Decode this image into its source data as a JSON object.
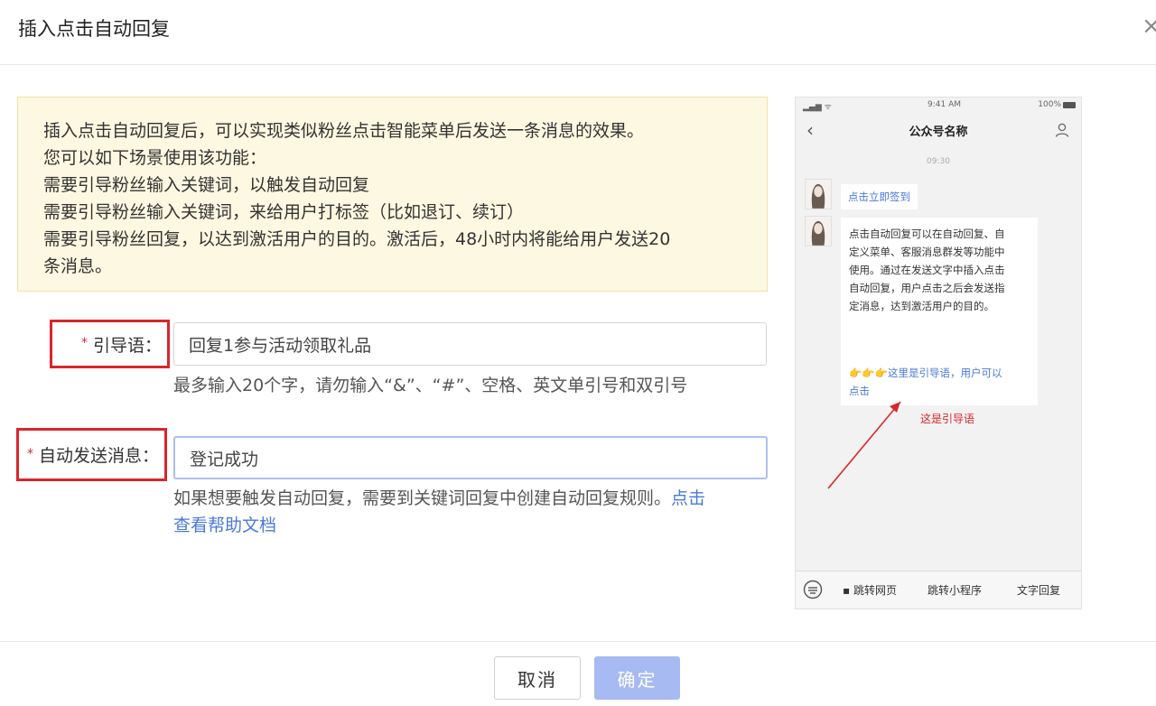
{
  "dialog": {
    "title": "插入点击自动回复",
    "close_glyph": "×"
  },
  "notice": {
    "lines": [
      "插入点击自动回复后，可以实现类似粉丝点击智能菜单后发送一条消息的效果。",
      "您可以如下场景使用该功能：",
      "需要引导粉丝输入关键词，以触发自动回复",
      "需要引导粉丝输入关键词，来给用户打标签（比如退订、续订）",
      "需要引导粉丝回复，以达到激活用户的目的。激活后，48小时内将能给用户发送20",
      "条消息。"
    ]
  },
  "form": {
    "guide": {
      "required_mark": "*",
      "label": "引导语：",
      "value": "回复1参与活动领取礼品",
      "hint": "最多输入20个字，请勿输入“&”、“#”、空格、英文单引号和双引号"
    },
    "auto_message": {
      "required_mark": "*",
      "label": "自动发送消息：",
      "value": "登记成功",
      "hint_line1": "如果想要触发自动回复，需要到关键词回复中创建自动回复规则。",
      "hint_link_part1": "点击",
      "hint_link_part2": "查看帮助文档"
    }
  },
  "phone_preview": {
    "status_signal": "▂▄▆ ᯤ",
    "status_time": "9:41 AM",
    "status_battery": "100%",
    "back_glyph": "‹",
    "title": "公众号名称",
    "chat_time": "09:30",
    "bubble1_text": "点击立即签到",
    "bubble2_lines": [
      "点击自动回复可以在自动回复、自",
      "定义菜单、客服消息群发等功能中",
      "使用。通过在发送文字中插入点击",
      "自动回复，用户点击之后会发送指",
      "定消息，达到激活用户的目的。"
    ],
    "bubble2_guide_line1": "👉👉👉这里是引导语，用户可以",
    "bubble2_guide_line2": "点击",
    "annotation": "这是引导语",
    "menu": {
      "item1": "▪ 跳转网页",
      "item2": "跳转小程序",
      "item3": "文字回复"
    },
    "annotation_color": "#d9262c"
  },
  "footer": {
    "cancel_label": "取消",
    "ok_label": "确定",
    "ok_color": "#a7baf2"
  }
}
